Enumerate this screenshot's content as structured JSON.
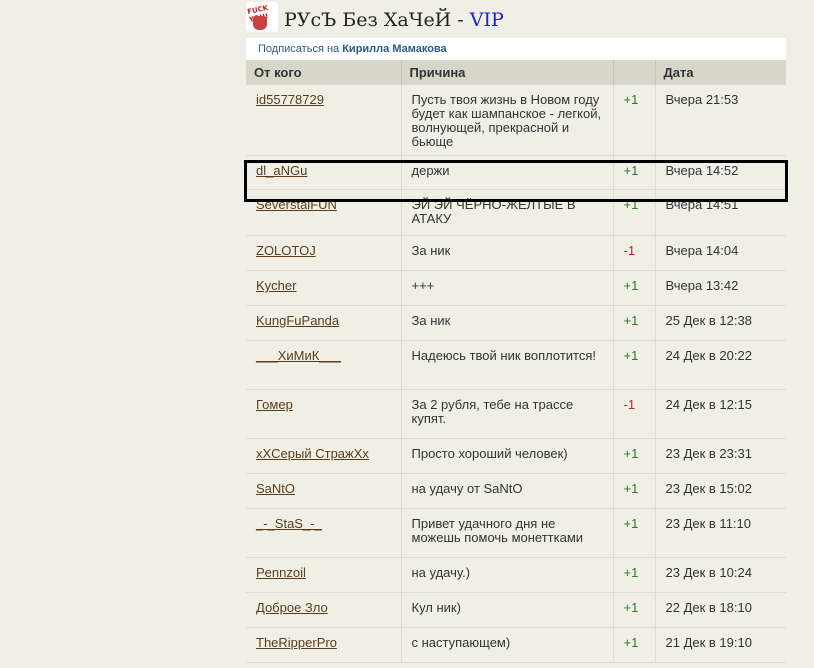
{
  "header": {
    "title": "РУсЪ Без ХаЧеЙ",
    "separator": " - ",
    "vip": "VIP",
    "logo_text": "FUCK YOU!"
  },
  "subscribe": {
    "prefix": "Подписаться на",
    "name": "Кирилла Мамакова"
  },
  "table": {
    "columns": [
      "От кого",
      "Причина",
      "",
      "Дата"
    ],
    "rows": [
      {
        "from": "id55778729",
        "reason": "Пусть твоя жизнь в Новом году будет как шампанское - легкой, волнующей, прекрасной и бьюще",
        "score": "+1",
        "date": "Вчера 21:53"
      },
      {
        "from": "dl_aNGu",
        "reason": "держи",
        "score": "+1",
        "date": "Вчера 14:52"
      },
      {
        "from": "SeverstalFUN",
        "reason": "ЭЙ ЭЙ ЧЁРНО-ЖЕЛТЫЕ В АТАКУ",
        "score": "+1",
        "date": "Вчера 14:51"
      },
      {
        "from": "ZOLOTOJ",
        "reason": "За ник",
        "score": "-1",
        "date": "Вчера 14:04"
      },
      {
        "from": "Kycher",
        "reason": "+++",
        "score": "+1",
        "date": "Вчера 13:42"
      },
      {
        "from": "KungFuPanda",
        "reason": "За ник",
        "score": "+1",
        "date": "25 Дек в 12:38"
      },
      {
        "from": "___ХиМиК___",
        "reason": "Надеюсь твой ник воплотится!",
        "score": "+1",
        "date": "24 Дек в 20:22"
      },
      {
        "from": "Гомер",
        "reason": "За 2 рубля, тебе на трассе купят.",
        "score": "-1",
        "date": "24 Дек в 12:15"
      },
      {
        "from": "xXСерый СтражXx",
        "reason": "Просто хороший человек)",
        "score": "+1",
        "date": "23 Дек в 23:31"
      },
      {
        "from": "SaNtO",
        "reason": "на удачу от SaNtO",
        "score": "+1",
        "date": "23 Дек в 15:02"
      },
      {
        "from": "_-_StaS_-_",
        "reason": "Привет удачного дня не можешь помочь монеттками",
        "score": "+1",
        "date": "23 Дек в 11:10"
      },
      {
        "from": "Pennzoil",
        "reason": "на удачу.)",
        "score": "+1",
        "date": "23 Дек в 10:24"
      },
      {
        "from": "Доброе Зло",
        "reason": "Кул ник)",
        "score": "+1",
        "date": "22 Дек в 18:10"
      },
      {
        "from": "TheRipperPro",
        "reason": "с наступающем)",
        "score": "+1",
        "date": "21 Дек в 19:10"
      }
    ]
  },
  "colors": {
    "background": "#efefe6",
    "header_bg": "#d7d7c9",
    "positive": "#2a7a2a",
    "negative": "#c82020",
    "link": "#5a3c1a",
    "vip": "#1a24c8"
  }
}
